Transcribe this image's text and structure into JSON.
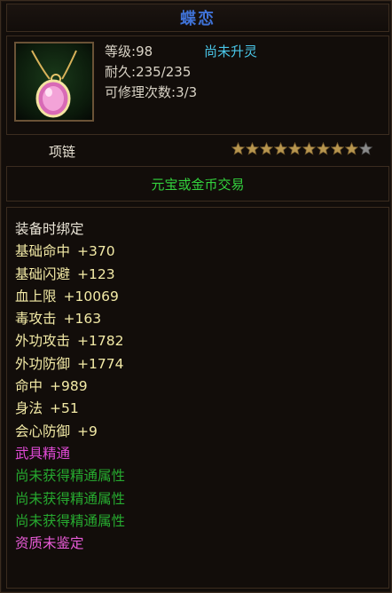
{
  "item": {
    "name": "蝶恋",
    "level_label": "等级",
    "level_value": ":98",
    "ascend_status": "尚未升灵",
    "durability_label": "耐久",
    "durability_value": ":235/235",
    "repair_label": "可修理次数",
    "repair_value": ":3/3",
    "type": "项链",
    "stars_filled": 9,
    "stars_total": 10,
    "trade": "元宝或金币交易",
    "bind": "装备时绑定",
    "stats": [
      {
        "label": "基础命中",
        "value": "+370"
      },
      {
        "label": "基础闪避",
        "value": "+123"
      },
      {
        "label": "血上限",
        "value": "+10069"
      },
      {
        "label": "毒攻击",
        "value": "+163"
      },
      {
        "label": "外功攻击",
        "value": "+1782"
      },
      {
        "label": "外功防御",
        "value": "+1774"
      },
      {
        "label": "命中",
        "value": "+989"
      },
      {
        "label": "身法",
        "value": "+51"
      },
      {
        "label": "会心防御",
        "value": "+9"
      }
    ],
    "mastery_title": "武具精通",
    "mastery_lines": [
      "尚未获得精通属性",
      "尚未获得精通属性",
      "尚未获得精通属性"
    ],
    "quality": "资质未鉴定",
    "icon": "pink-gem-necklace"
  },
  "colors": {
    "title": "#3f72d6",
    "ascend": "#49c6e8",
    "trade": "#33d23d",
    "stat": "#f3eaa6",
    "mastery": "#e04ad5",
    "unobtained": "#26a92f"
  }
}
